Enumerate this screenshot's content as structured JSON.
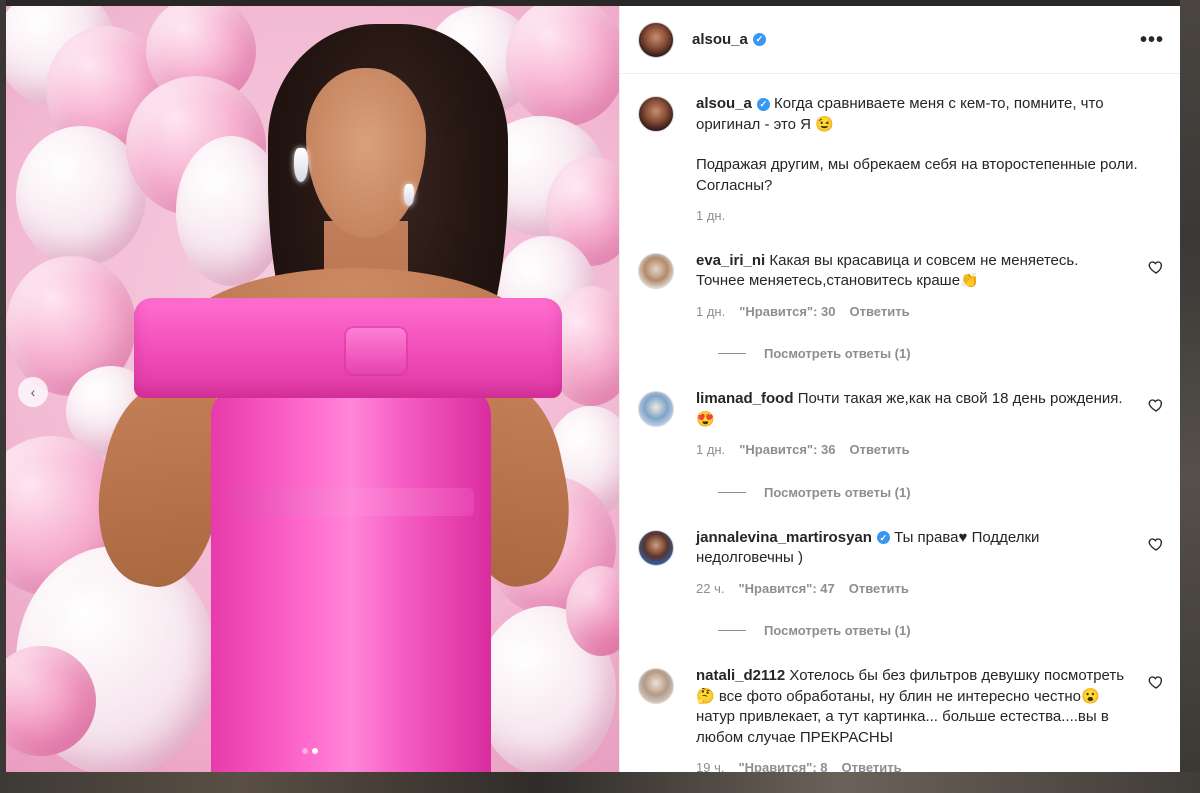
{
  "post": {
    "username": "alsou_a",
    "verified": true,
    "more_label": "•••"
  },
  "carousel": {
    "prev_label": "‹",
    "slides": 2,
    "active_slide": 2
  },
  "caption": {
    "username": "alsou_a",
    "text_1": "Когда сравниваете меня с кем-то, помните, что оригинал - это Я 😉",
    "text_2": "Подражая другим, мы обрекаем себя на второстепенные роли. Согласны?",
    "time": "1 дн."
  },
  "comments": [
    {
      "username": "eva_iri_ni",
      "verified": false,
      "text": "Какая вы красавица и совсем не меняетесь. Точнее меняетесь,становитесь краше👏",
      "time": "1 дн.",
      "likes": "\"Нравится\": 30",
      "reply": "Ответить",
      "view_replies": "Посмотреть ответы (1)"
    },
    {
      "username": "limanad_food",
      "verified": false,
      "text": "Почти такая же,как на свой 18 день рождения.😍",
      "time": "1 дн.",
      "likes": "\"Нравится\": 36",
      "reply": "Ответить",
      "view_replies": "Посмотреть ответы (1)"
    },
    {
      "username": "jannalevina_martirosyan",
      "verified": true,
      "text": "Ты права♥ Подделки недолговечны )",
      "time": "22 ч.",
      "likes": "\"Нравится\": 47",
      "reply": "Ответить",
      "view_replies": "Посмотреть ответы (1)"
    },
    {
      "username": "natali_d2112",
      "verified": false,
      "text": "Хотелось бы без фильтров девушку посмотреть🤔 все фото обработаны, ну блин не интересно честно😮 натур привлекает, а тут картинка... больше естества....вы в любом случае ПРЕКРАСНЫ",
      "time": "19 ч.",
      "likes": "\"Нравится\": 8",
      "reply": "Ответить"
    }
  ],
  "colors": {
    "verified_blue": "#3897f0",
    "muted": "#8e8e8e",
    "dress_pink": "#ff5fc8"
  }
}
